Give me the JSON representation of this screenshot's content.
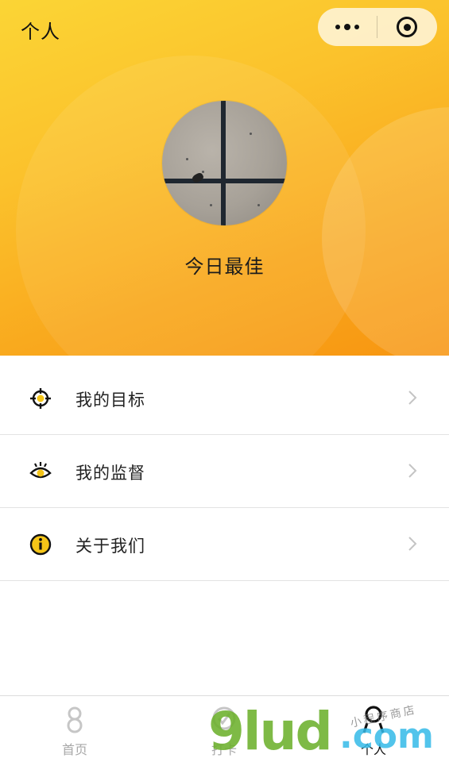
{
  "nav": {
    "title": "个人",
    "capsule": {
      "more_icon": "more-dots-icon",
      "close_icon": "target-close-icon"
    }
  },
  "profile": {
    "avatar_icon": "avatar-photo",
    "nickname": "今日最佳"
  },
  "menu": {
    "items": [
      {
        "label": "我的目标",
        "icon": "target-crosshair-icon"
      },
      {
        "label": "我的监督",
        "icon": "eye-icon"
      },
      {
        "label": "关于我们",
        "icon": "info-icon"
      }
    ]
  },
  "tabbar": {
    "tabs": [
      {
        "label": "首页",
        "icon": "infinity-icon",
        "active": false
      },
      {
        "label": "打卡",
        "icon": "checkin-icon",
        "active": false
      },
      {
        "label": "个人",
        "icon": "person-icon",
        "active": true
      }
    ]
  },
  "watermark": {
    "main": "9lud",
    "suffix": ".com",
    "sub": "小程序商店"
  },
  "colors": {
    "hero_start": "#fbd535",
    "hero_end": "#f79510",
    "icon_yellow": "#f5c518",
    "text_dark": "#222222",
    "tab_inactive": "#a8a8a8",
    "watermark_green": "#6cb02c",
    "watermark_blue": "#34bae8"
  }
}
